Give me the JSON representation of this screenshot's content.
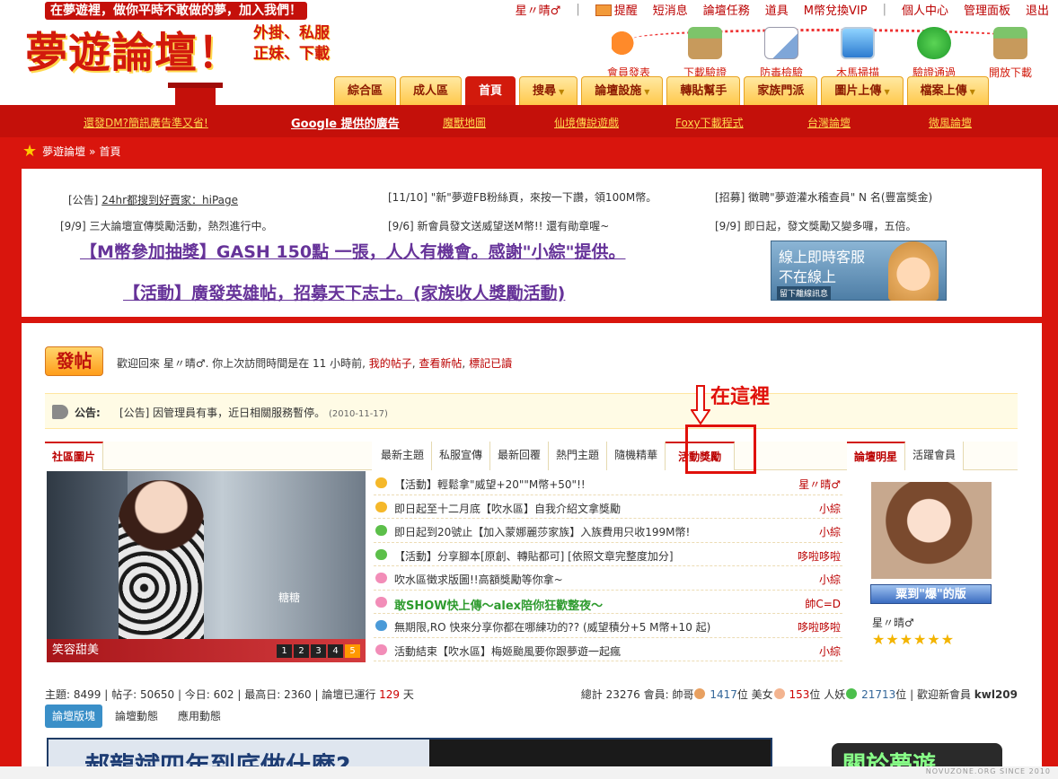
{
  "header": {
    "slogan": "在夢遊裡，做你平時不敢做的夢，加入我們！",
    "logo": "夢遊論壇！",
    "logo_sub1": "外掛、私服",
    "logo_sub2": "正妹、下載",
    "topnav": {
      "username": "星〃晴♂",
      "items": [
        "提醒",
        "短消息",
        "論壇任務",
        "道具",
        "M幣兌換VIP",
        "個人中心",
        "管理面板",
        "退出"
      ]
    },
    "quick": [
      "會員發表",
      "下載驗證",
      "防毒檢驗",
      "木馬掃描",
      "驗證通過",
      "開放下載"
    ],
    "mainnav": [
      "綜合區",
      "成人區",
      "首頁",
      "搜尋",
      "論壇設施",
      "轉貼幫手",
      "家族門派",
      "圖片上傳",
      "檔案上傳"
    ],
    "mainnav_active": "首頁"
  },
  "adbar": {
    "links": [
      "還發DM?簡訊廣告準又省!",
      "Google 提供的廣告",
      "魔獸地圖",
      "仙境傳說遊戲",
      "Foxy下載程式",
      "台灣論壇",
      "微風論壇"
    ]
  },
  "breadcrumb": {
    "home": "夢遊論壇",
    "sep": "»",
    "current": "首頁"
  },
  "notices": {
    "n1_prefix": "[公告]",
    "n1_link": "24hr都搜到好賣家：hiPage",
    "n2": "[11/10] \"新\"夢遊FB粉絲頁，來按一下讚，領100M幣。",
    "n3": "[招募] 徵聘\"夢遊灌水稽查員\" N 名(豐富獎金)",
    "n4": "[9/9] 三大論壇宣傳獎勵活動，熱烈進行中。",
    "n5": "[9/6] 新會員發文送威望送M幣!! 還有勛章喔~",
    "n6": "[9/9] 即日起，發文獎勵又變多囉，五倍。",
    "big1": "【M幣參加抽獎】GASH 150點 一張，人人有機會。感謝\"小綜\"提供。",
    "big2": "【活動】廣發英雄帖，招募天下志士。(家族收人獎勵活動)"
  },
  "service": {
    "line1": "線上即時客服",
    "line2": "不在線上",
    "line3": "留下離線訊息"
  },
  "main": {
    "post_button": "發帖",
    "welcome_text": "歡迎回來 星〃晴♂. 你上次訪問時間是在 11 小時前,",
    "my_posts": "我的帖子",
    "new_posts": "查看新帖",
    "mark_read": "標記已讀",
    "announce_label": "公告:",
    "announce_text": "[公告] 因管理員有事，近日相關服務暫停。",
    "announce_date": "(2010-11-17)",
    "annotation": "在這裡"
  },
  "tabs": {
    "left": [
      "社區圖片"
    ],
    "middle": [
      "最新主題",
      "私服宣傳",
      "最新回覆",
      "熱門主題",
      "隨機精華",
      "活動獎勵"
    ],
    "middle_active": "活動獎勵",
    "right": [
      "論壇明星",
      "活躍會員"
    ]
  },
  "photo": {
    "caption": "笑容甜美",
    "art_label": "糖糖",
    "pages": [
      "1",
      "2",
      "3",
      "4",
      "5"
    ],
    "active_page": "5"
  },
  "threads": [
    {
      "title": "【活動】輕鬆拿\"威望+20\"\"M幣+50\"!!",
      "author": "星〃晴♂",
      "color": "#f5b82a"
    },
    {
      "title": "即日起至十二月底【吹水區】自我介紹文拿獎勵",
      "author": "小綜",
      "color": "#f5b82a"
    },
    {
      "title": "即日起到20號止【加入蒙娜麗莎家族】入族費用只收199M幣!",
      "author": "小綜",
      "color": "#5cbf4a"
    },
    {
      "title": "【活動】分享腳本[原創、轉貼都可] [依照文章完整度加分]",
      "author": "哆啦哆啦",
      "color": "#5cbf4a"
    },
    {
      "title": "吹水區徵求版圖!!高額獎勵等你拿~",
      "author": "小綜",
      "color": "#f28db8"
    },
    {
      "title": "敢SHOW快上傳～alex陪你狂歡整夜～",
      "author": "帥C=D",
      "color": "#f28db8",
      "green": true
    },
    {
      "title": "無期限,RO 快來分享你都在哪練功的?? (威望積分+5 M幣+10 起)",
      "author": "哆啦哆啦",
      "color": "#4a9ad8"
    },
    {
      "title": "活動結束【吹水區】梅姬颱風要你跟夢遊一起瘋",
      "author": "小綜",
      "color": "#f28db8"
    }
  ],
  "star": {
    "banner": "粟到\"爆\"的版",
    "name": "星〃晴♂",
    "rating": "★★★★★★"
  },
  "stats": {
    "topics": "8499",
    "posts": "50650",
    "today": "602",
    "max_daily": "2360",
    "days": "129",
    "total_members": "23276",
    "male": "1417",
    "female": "153",
    "other": "21713",
    "newest": "kwl209"
  },
  "bottom_tabs": [
    "論壇版塊",
    "論壇動態",
    "應用動態"
  ],
  "banner_text": "郝龍斌四年到底做什麼?",
  "rbanner_text": "關於夢遊",
  "footer": "NOVUZONE.ORG SINCE 2010"
}
